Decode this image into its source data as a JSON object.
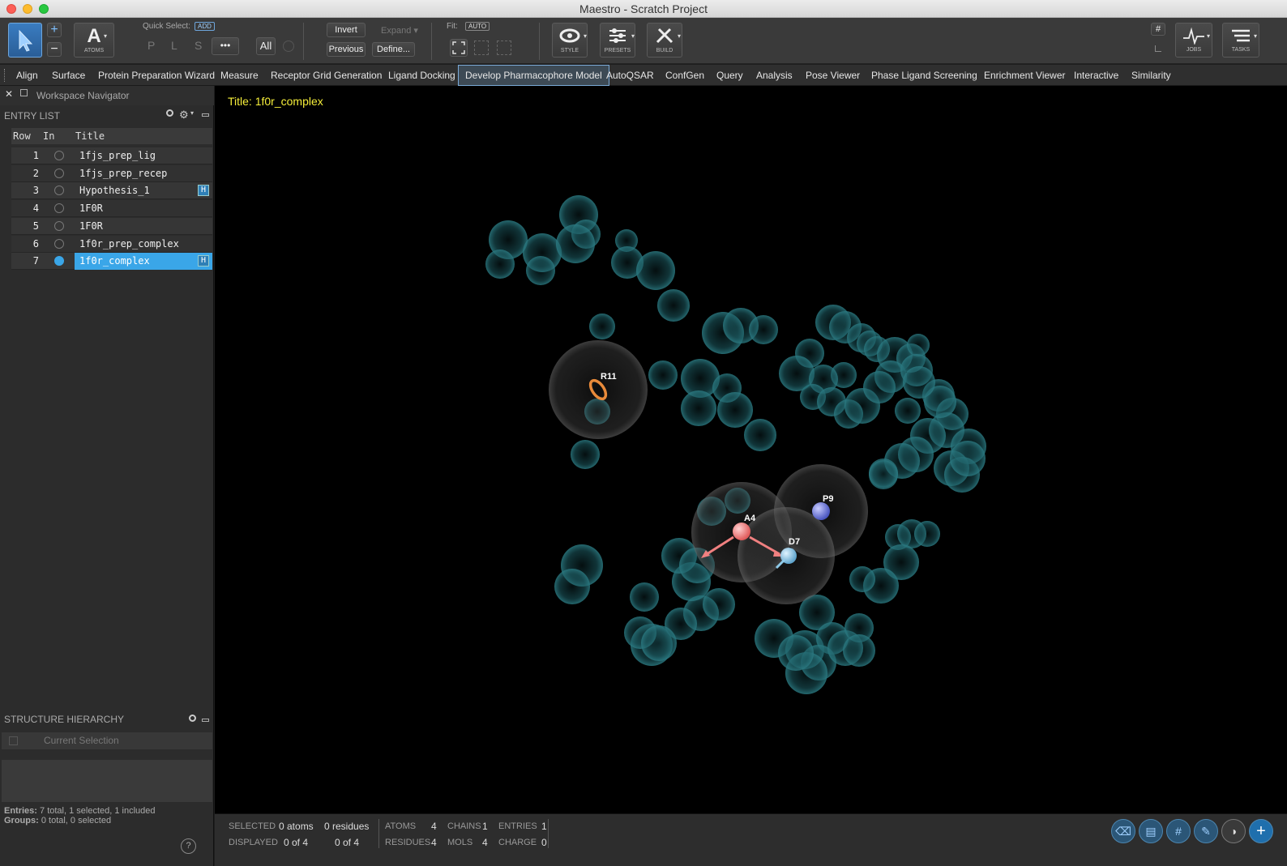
{
  "window": {
    "title": "Maestro - Scratch Project"
  },
  "toolbar": {
    "atoms_label": "ATOMS",
    "quick_select_label": "Quick Select:",
    "add_badge": "ADD",
    "p_label": "P",
    "l_label": "L",
    "s_label": "S",
    "more_label": "•••",
    "all_label": "All",
    "invert_label": "Invert",
    "expand_label": "Expand ▾",
    "previous_label": "Previous",
    "define_label": "Define...",
    "fit_label": "Fit:",
    "auto_badge": "AUTO",
    "style_label": "STYLE",
    "presets_label": "PRESETS",
    "build_label": "BUILD",
    "jobs_label": "JOBS",
    "tasks_label": "TASKS",
    "hash_label": "#"
  },
  "tabs": [
    "Align",
    "Surface",
    "Protein Preparation Wizard",
    "Measure",
    "Receptor Grid Generation",
    "Ligand Docking",
    "Develop Pharmacophore Model",
    "AutoQSAR",
    "ConfGen",
    "Query",
    "Analysis",
    "Pose Viewer",
    "Phase Ligand Screening",
    "Enrichment Viewer",
    "Interactive",
    "Similarity"
  ],
  "navigator": {
    "title": "Workspace Navigator",
    "entry_list_label": "ENTRY LIST",
    "columns": {
      "row": "Row",
      "in": "In",
      "title": "Title"
    },
    "rows": [
      {
        "num": "1",
        "title": "1fjs_prep_lig",
        "in": false,
        "h": ""
      },
      {
        "num": "2",
        "title": "1fjs_prep_recep",
        "in": false,
        "h": ""
      },
      {
        "num": "3",
        "title": "Hypothesis_1",
        "in": false,
        "h": "H"
      },
      {
        "num": "4",
        "title": "1F0R",
        "in": false,
        "h": ""
      },
      {
        "num": "5",
        "title": "1F0R",
        "in": false,
        "h": ""
      },
      {
        "num": "6",
        "title": "1f0r_prep_complex",
        "in": false,
        "h": ""
      },
      {
        "num": "7",
        "title": "1f0r_complex",
        "in": true,
        "h": "H"
      }
    ],
    "structure_hierarchy_label": "STRUCTURE HIERARCHY",
    "current_selection_label": "Current Selection",
    "entries_label": "Entries:",
    "entries_text": "7 total, 1 selected, 1 included",
    "groups_label": "Groups:",
    "groups_text": "0 total, 0 selected",
    "help_label": "?"
  },
  "viewport": {
    "title_text": "Title: 1f0r_complex",
    "features": {
      "r11": "R11",
      "a4": "A4",
      "d7": "D7",
      "p9": "P9"
    },
    "colors": {
      "title": "#f5ee3a",
      "sphere": "#1e5f66",
      "acceptor": "#f08080",
      "donor": "#8ec9e8",
      "positive": "#6f7fe0",
      "ring": "#e88a3a"
    }
  },
  "status": {
    "selected_label": "SELECTED",
    "selected_atoms": "0 atoms",
    "selected_residues": "0 residues",
    "displayed_label": "DISPLAYED",
    "displayed_atoms": "0 of 4",
    "displayed_residues": "0 of 4",
    "atoms_label": "ATOMS",
    "atoms_val": "4",
    "residues_label": "RESIDUES",
    "residues_val": "4",
    "chains_label": "CHAINS",
    "chains_val": "1",
    "mols_label": "MOLS",
    "mols_val": "4",
    "entries_label": "ENTRIES",
    "entries_val": "1",
    "charge_label": "CHARGE",
    "charge_val": "0"
  }
}
